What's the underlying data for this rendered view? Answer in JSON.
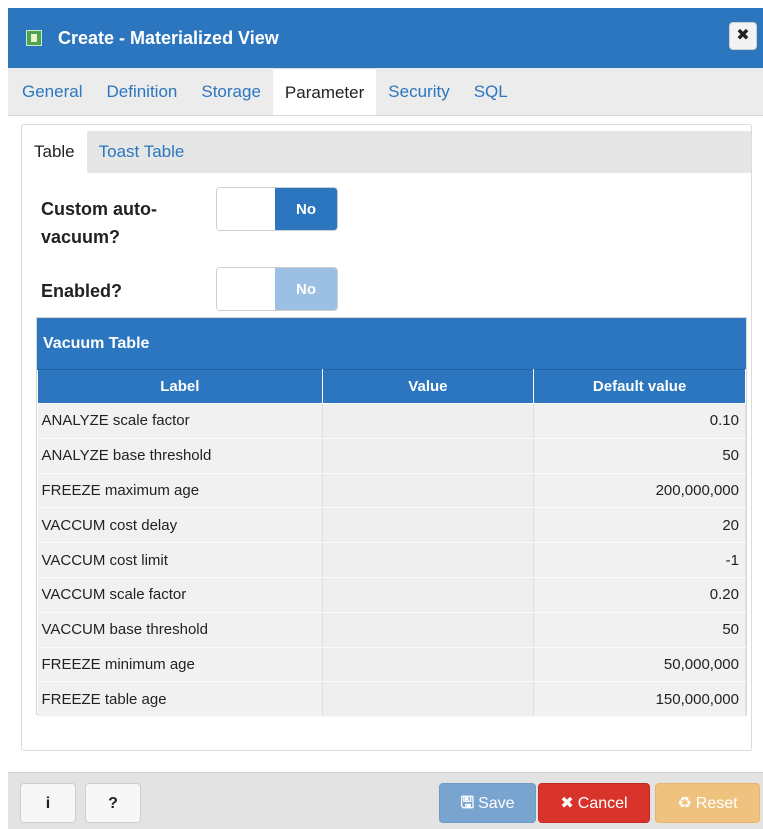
{
  "window": {
    "title": "Create - Materialized View",
    "close_icon": "close-icon"
  },
  "tabs": [
    {
      "label": "General"
    },
    {
      "label": "Definition"
    },
    {
      "label": "Storage"
    },
    {
      "label": "Parameter",
      "active": true
    },
    {
      "label": "Security"
    },
    {
      "label": "SQL"
    }
  ],
  "subtabs": [
    {
      "label": "Table",
      "active": true
    },
    {
      "label": "Toast Table"
    }
  ],
  "fields": {
    "custom_autovacuum": {
      "label_line1": "Custom auto-",
      "label_line2": "vacuum?",
      "value": "No"
    },
    "enabled": {
      "label": "Enabled?",
      "value": "No"
    }
  },
  "vacuum_table": {
    "title": "Vacuum Table",
    "columns": [
      "Label",
      "Value",
      "Default value"
    ],
    "rows": [
      {
        "label": "ANALYZE scale factor",
        "value": "",
        "default": "0.10"
      },
      {
        "label": "ANALYZE base threshold",
        "value": "",
        "default": "50"
      },
      {
        "label": "FREEZE maximum age",
        "value": "",
        "default": "200,000,000"
      },
      {
        "label": "VACCUM cost delay",
        "value": "",
        "default": "20"
      },
      {
        "label": "VACCUM cost limit",
        "value": "",
        "default": "-1"
      },
      {
        "label": "VACCUM scale factor",
        "value": "",
        "default": "0.20"
      },
      {
        "label": "VACCUM base threshold",
        "value": "",
        "default": "50"
      },
      {
        "label": "FREEZE minimum age",
        "value": "",
        "default": "50,000,000"
      },
      {
        "label": "FREEZE table age",
        "value": "",
        "default": "150,000,000"
      }
    ]
  },
  "footer": {
    "info_label": "i",
    "help_label": "?",
    "save_label": "Save",
    "cancel_label": "Cancel",
    "reset_label": "Reset"
  },
  "colors": {
    "accent": "#2c76bf",
    "cancel": "#d9342b",
    "reset": "#f0c27f",
    "save_disabled": "#7aa4d0"
  }
}
